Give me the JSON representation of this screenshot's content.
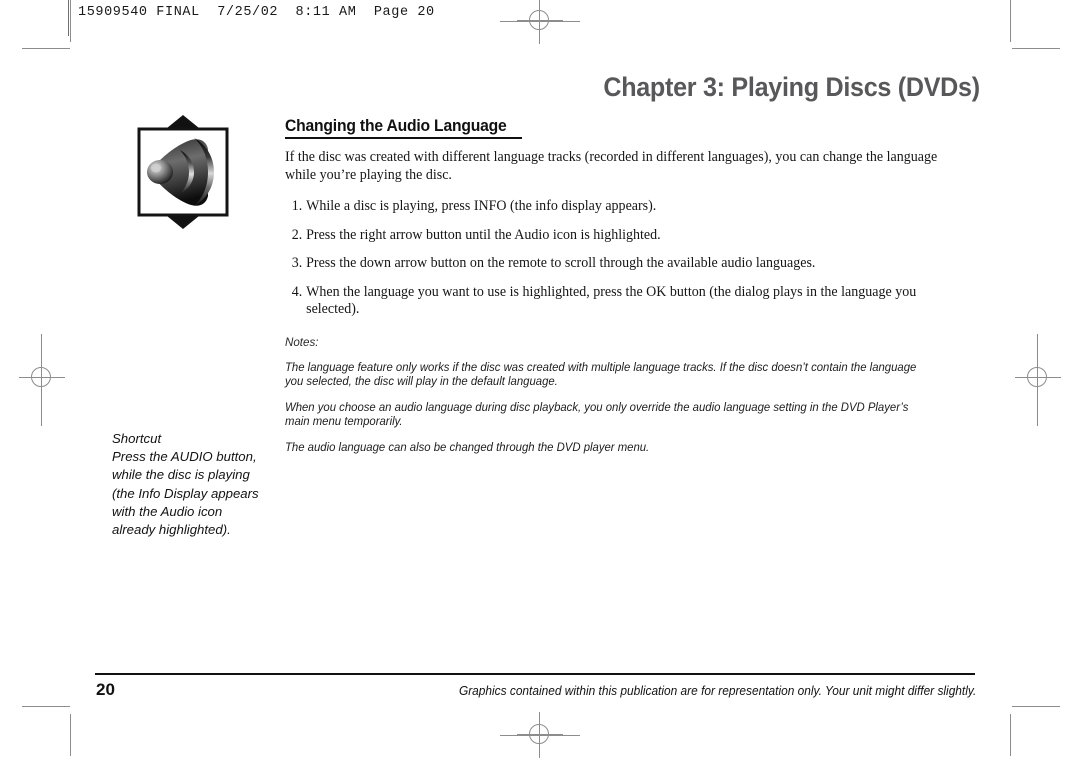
{
  "slug": {
    "text": "15909540 FINAL  7/25/02  8:11 AM  Page 20"
  },
  "header": {
    "chapter_title": "Chapter 3: Playing Discs (DVDs)"
  },
  "section": {
    "heading": "Changing the Audio Language",
    "intro": "If the disc was created with different language tracks (recorded in different languages), you can change the language while you’re playing the disc."
  },
  "steps": [
    {
      "num": "1.",
      "text": "While a disc is playing, press INFO (the info display appears)."
    },
    {
      "num": "2.",
      "text": "Press the right arrow button until the Audio icon is highlighted."
    },
    {
      "num": "3.",
      "text": "Press the down arrow button on the remote to scroll through the available audio languages."
    },
    {
      "num": "4.",
      "text": "When the language you want to use is highlighted, press the OK button (the dialog plays in the language you selected)."
    }
  ],
  "notes": {
    "label": "Notes:",
    "items": [
      "The language feature only works if the disc was created with multiple language tracks. If the disc doesn’t contain the language you selected, the disc will play in the default language.",
      "When you choose an audio language during disc playback, you only override the audio language setting in the DVD Player’s main menu temporarily.",
      "The audio language can also be changed through the DVD player menu."
    ]
  },
  "shortcut": {
    "title": "Shortcut",
    "lines": [
      "Press the AUDIO button,",
      "while the disc is playing",
      "(the Info Display appears",
      "with the Audio icon",
      "already highlighted)."
    ]
  },
  "illustration": {
    "caption_icon": "audio-speaker-icon",
    "up_arrow": "up-triangle-icon",
    "down_arrow": "down-triangle-icon"
  },
  "footer": {
    "page_number": "20",
    "disclaimer": "Graphics contained within this publication are for representation only. Your unit might differ slightly."
  },
  "colors": {
    "chapter_title": "#58585a",
    "body_text": "#161616",
    "mark_gray": "#8d8d8d"
  }
}
